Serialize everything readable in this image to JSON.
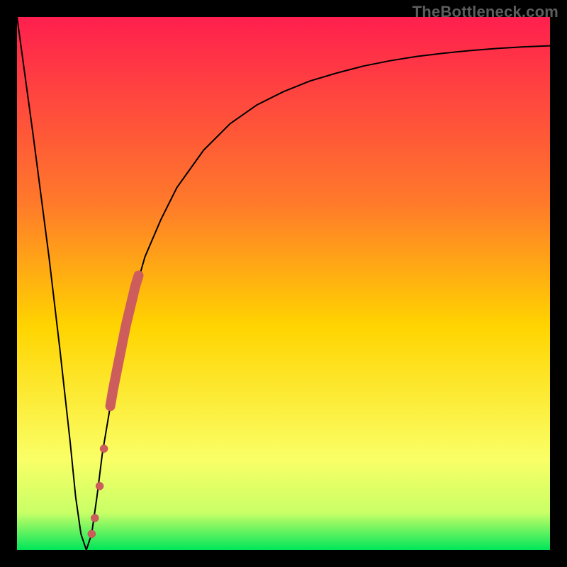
{
  "watermark": "TheBottleneck.com",
  "colors": {
    "frame": "#000000",
    "gradient_top": "#ff1f4e",
    "gradient_mid_upper": "#ff7a2a",
    "gradient_mid": "#ffd400",
    "gradient_lower": "#faff66",
    "gradient_band": "#c9ff66",
    "gradient_bottom": "#00e65a",
    "curve": "#000000",
    "marker_fill": "#cd5c5c",
    "marker_stroke": "#b84a4a"
  },
  "chart_data": {
    "type": "line",
    "title": "",
    "xlabel": "",
    "ylabel": "",
    "xlim": [
      0,
      100
    ],
    "ylim": [
      0,
      100
    ],
    "grid": false,
    "legend": null,
    "series": [
      {
        "name": "bottleneck-curve",
        "x": [
          0,
          3,
          6,
          8,
          10,
          11,
          12,
          13,
          14,
          15,
          16,
          18,
          20,
          22,
          24,
          27,
          30,
          35,
          40,
          45,
          50,
          55,
          60,
          65,
          70,
          75,
          80,
          85,
          90,
          95,
          100
        ],
        "values": [
          100,
          78,
          55,
          38,
          20,
          10,
          3,
          0,
          3,
          10,
          18,
          30,
          40,
          48,
          55,
          62,
          68,
          75,
          80,
          83.5,
          86,
          88,
          89.5,
          90.8,
          91.8,
          92.6,
          93.2,
          93.7,
          94.1,
          94.4,
          94.6
        ]
      }
    ],
    "markers": [
      {
        "name": "highlight-segment",
        "x": [
          17.5,
          18,
          18.6,
          19.2,
          19.8,
          20.4,
          21,
          21.6,
          22.2,
          22.8
        ],
        "y": [
          27,
          30,
          33,
          36,
          39,
          42,
          44.5,
          47,
          49.5,
          51.5
        ]
      },
      {
        "name": "near-minimum-dots",
        "x": [
          14.0,
          14.6,
          15.5,
          16.3
        ],
        "y": [
          3,
          6,
          12,
          19
        ]
      }
    ],
    "minimum": {
      "x": 13,
      "y": 0
    }
  }
}
